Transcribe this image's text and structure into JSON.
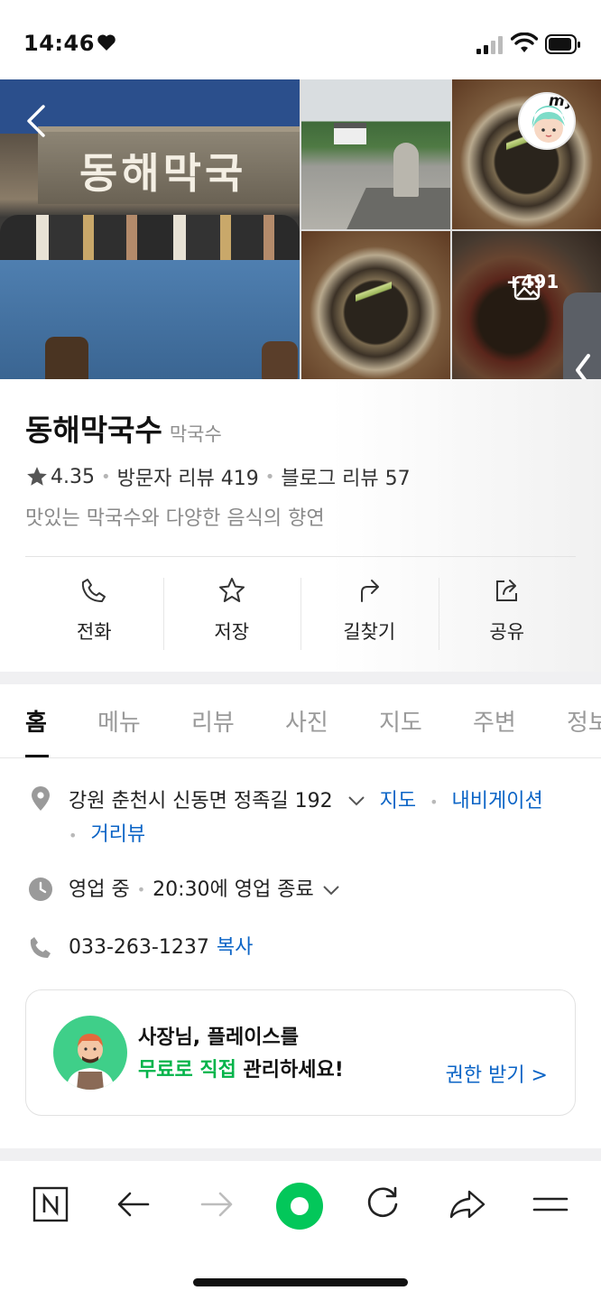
{
  "status_bar": {
    "time": "14:46"
  },
  "photos": {
    "more_count": "+491"
  },
  "place": {
    "name": "동해막국수",
    "category": "막국수",
    "rating": "4.35",
    "visitor_reviews": "방문자 리뷰 419",
    "blog_reviews": "블로그 리뷰 57",
    "description": "맛있는 막국수와 다양한 음식의 향연"
  },
  "actions": [
    {
      "label": "전화"
    },
    {
      "label": "저장"
    },
    {
      "label": "길찾기"
    },
    {
      "label": "공유"
    }
  ],
  "tabs": [
    {
      "label": "홈"
    },
    {
      "label": "메뉴"
    },
    {
      "label": "리뷰"
    },
    {
      "label": "사진"
    },
    {
      "label": "지도"
    },
    {
      "label": "주변"
    },
    {
      "label": "정보"
    }
  ],
  "details": {
    "address": "강원 춘천시 신동면 정족길 192",
    "map_link": "지도",
    "navigation_link": "내비게이션",
    "street_view_link": "거리뷰",
    "hours_status": "영업 중",
    "hours_close": "20:30에 영업 종료",
    "phone": "033-263-1237",
    "copy_label": "복사"
  },
  "owner_banner": {
    "line1": "사장님, 플레이스를",
    "line2_highlight": "무료로 직접",
    "line2_rest": " 관리하세요!",
    "cta": "권한 받기 >"
  },
  "colors": {
    "accent_blue": "#0b64c6",
    "brand_green": "#03c75a"
  }
}
